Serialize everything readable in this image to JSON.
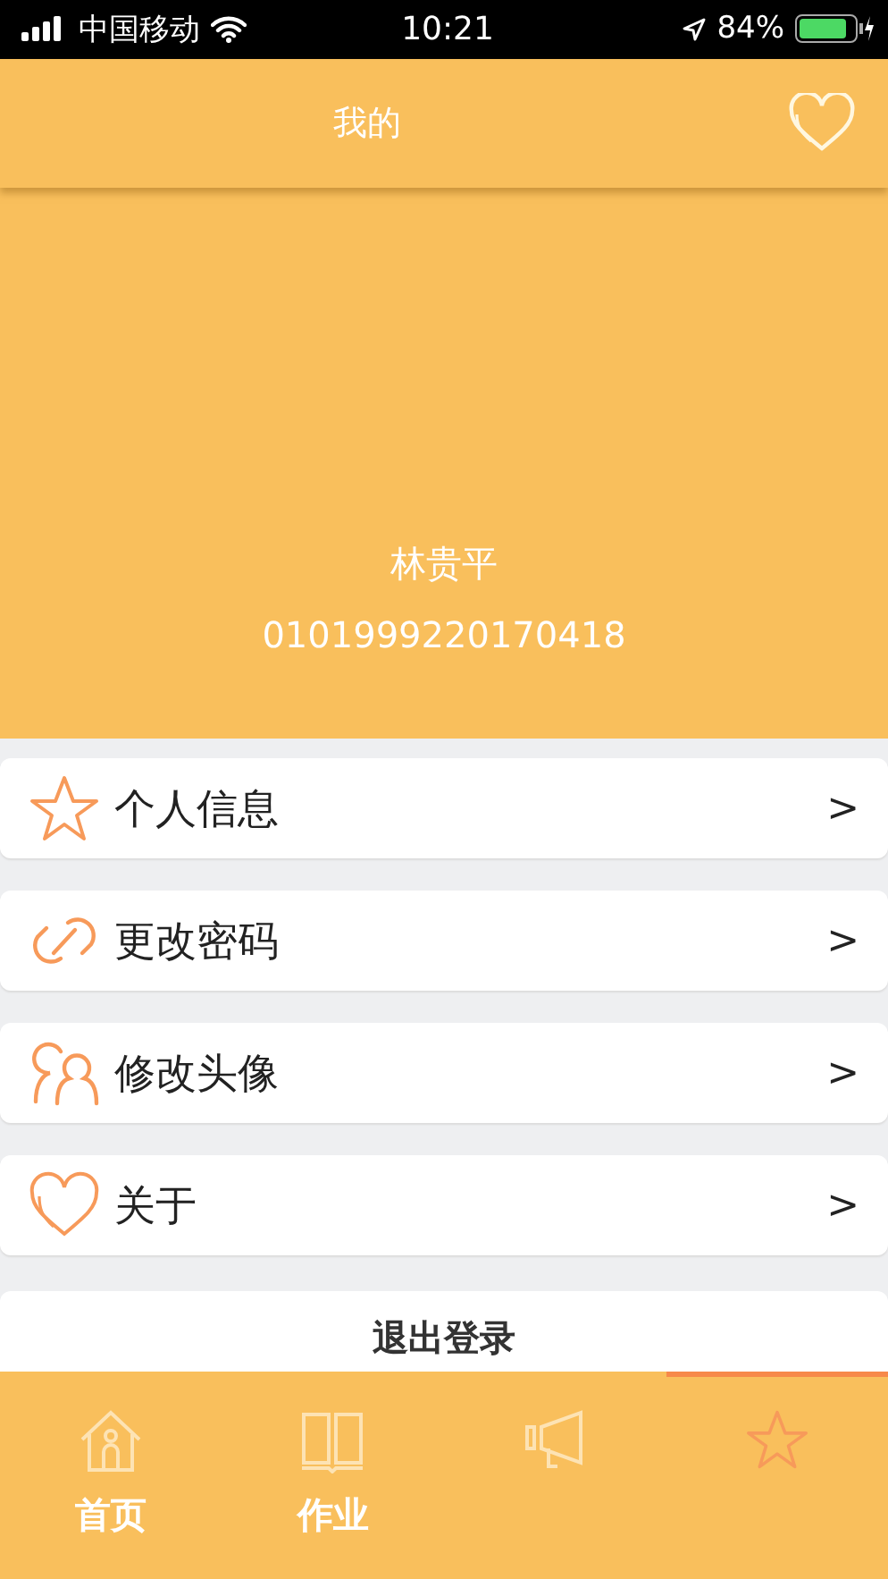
{
  "status_bar": {
    "carrier": "中国移动",
    "time": "10:21",
    "battery": "84%"
  },
  "header": {
    "title": "我的"
  },
  "profile": {
    "name": "林贵平",
    "id": "0101999220170418"
  },
  "menu": [
    {
      "kind": "star",
      "label": "个人信息",
      "chevron": ">"
    },
    {
      "kind": "link",
      "label": "更改密码",
      "chevron": ">"
    },
    {
      "kind": "people",
      "label": "修改头像",
      "chevron": ">"
    },
    {
      "kind": "heart",
      "label": "关于",
      "chevron": ">"
    }
  ],
  "logout": "退出登录",
  "tabs": [
    {
      "kind": "home",
      "label": "首页",
      "selected": false
    },
    {
      "kind": "book",
      "label": "作业",
      "selected": false
    },
    {
      "kind": "megaphone",
      "selected": false
    },
    {
      "kind": "star",
      "selected": true
    }
  ]
}
